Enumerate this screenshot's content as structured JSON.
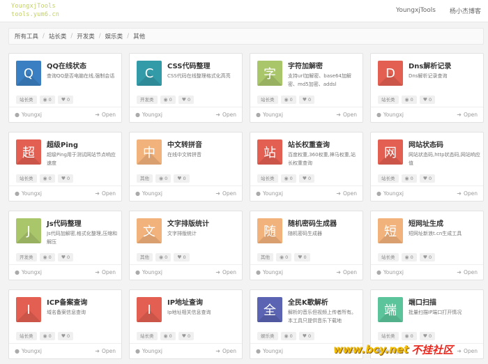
{
  "nav": {
    "logo_line1": "YoungxjTools",
    "logo_line2": "tools.yum6.cn",
    "links": [
      "YoungxjTools",
      "杨小杰博客"
    ]
  },
  "breadcrumb": [
    "所有工具",
    "站长类",
    "开发类",
    "娱乐类",
    "其他"
  ],
  "watermark": {
    "url": "www.bcy.net",
    "name": "不挂社区"
  },
  "colors": {
    "blue": "#3a7fc1",
    "teal": "#339aa8",
    "green": "#a9c66b",
    "red": "#e35f52",
    "orange": "#f2b27b",
    "pink": "#f4a6a0",
    "purple": "#5a64b3",
    "mint": "#5cc49a"
  },
  "cards": [
    {
      "letter": "Q",
      "color": "#3a7fc1",
      "title": "QQ在线状态",
      "desc": "查询QQ是否电脑在线,强制会话",
      "category": "站长类",
      "views": "0",
      "likes": "0",
      "author": "Youngxj",
      "open": "Open"
    },
    {
      "letter": "C",
      "color": "#339aa8",
      "title": "CSS代码整理",
      "desc": "CSS代码在线整理格式化高亮",
      "category": "开发类",
      "views": "0",
      "likes": "0",
      "author": "Youngxj",
      "open": "Open"
    },
    {
      "letter": "字",
      "color": "#a9c66b",
      "title": "字符加解密",
      "desc": "支持url加解密、base64加解密、md5加密、addsl",
      "category": "站长类",
      "views": "0",
      "likes": "0",
      "author": "Youngxj",
      "open": "Open"
    },
    {
      "letter": "D",
      "color": "#e35f52",
      "title": "Dns解析记录",
      "desc": "Dns解析记录查询",
      "category": "站长类",
      "views": "0",
      "likes": "0",
      "author": "Youngxj",
      "open": "Open"
    },
    {
      "letter": "超",
      "color": "#e35f52",
      "title": "超级Ping",
      "desc": "超级Ping用于测试网站节点响应速度",
      "category": "站长类",
      "views": "0",
      "likes": "0",
      "author": "Youngxj",
      "open": "Open"
    },
    {
      "letter": "中",
      "color": "#f2b27b",
      "title": "中文转拼音",
      "desc": "在线中文转拼音",
      "category": "其他",
      "views": "0",
      "likes": "0",
      "author": "Youngxj",
      "open": "Open"
    },
    {
      "letter": "站",
      "color": "#e35f52",
      "title": "站长权重查询",
      "desc": "百度权重,360权重,神马权重,站长权重查询",
      "category": "站长类",
      "views": "0",
      "likes": "0",
      "author": "Youngxj",
      "open": "Open"
    },
    {
      "letter": "网",
      "color": "#e35f52",
      "title": "网站状态码",
      "desc": "网站状态码,http状态码,网站响应值",
      "category": "站长类",
      "views": "0",
      "likes": "0",
      "author": "Youngxj",
      "open": "Open"
    },
    {
      "letter": "J",
      "color": "#a9c66b",
      "title": "Js代码整理",
      "desc": "Js代码加解密,格式化整理,压缩和解压",
      "category": "开发类",
      "views": "0",
      "likes": "0",
      "author": "Youngxj",
      "open": "Open"
    },
    {
      "letter": "文",
      "color": "#f2b27b",
      "title": "文字排版统计",
      "desc": "文字排版统计",
      "category": "其他",
      "views": "0",
      "likes": "0",
      "author": "Youngxj",
      "open": "Open"
    },
    {
      "letter": "随",
      "color": "#f2b27b",
      "title": "随机密码生成器",
      "desc": "随机密码生成器",
      "category": "其他",
      "views": "0",
      "likes": "0",
      "author": "Youngxj",
      "open": "Open"
    },
    {
      "letter": "短",
      "color": "#f2b27b",
      "title": "短网址生成",
      "desc": "短网址新浪t.cn生成工具",
      "category": "站长类",
      "views": "0",
      "likes": "0",
      "author": "Youngxj",
      "open": "Open"
    },
    {
      "letter": "I",
      "color": "#e35f52",
      "title": "ICP备案查询",
      "desc": "域名备案信息查询",
      "category": "站长类",
      "views": "0",
      "likes": "0",
      "author": "Youngxj",
      "open": "Open"
    },
    {
      "letter": "I",
      "color": "#e35f52",
      "title": "IP地址查询",
      "desc": "Ip地址相关信息查询",
      "category": "站长类",
      "views": "0",
      "likes": "0",
      "author": "Youngxj",
      "open": "Open"
    },
    {
      "letter": "全",
      "color": "#5a64b3",
      "title": "全民K歌解析",
      "desc": "解析的音乐但视频上传者所有。本工具只提供音乐下载地",
      "category": "娱乐类",
      "views": "0",
      "likes": "0",
      "author": "Youngxj",
      "open": "Open"
    },
    {
      "letter": "端",
      "color": "#5cc49a",
      "title": "端口扫描",
      "desc": "批量扫描IP端口打开情况",
      "category": "站长类",
      "views": "0",
      "likes": "0",
      "author": "Youngxj",
      "open": "Open"
    }
  ]
}
